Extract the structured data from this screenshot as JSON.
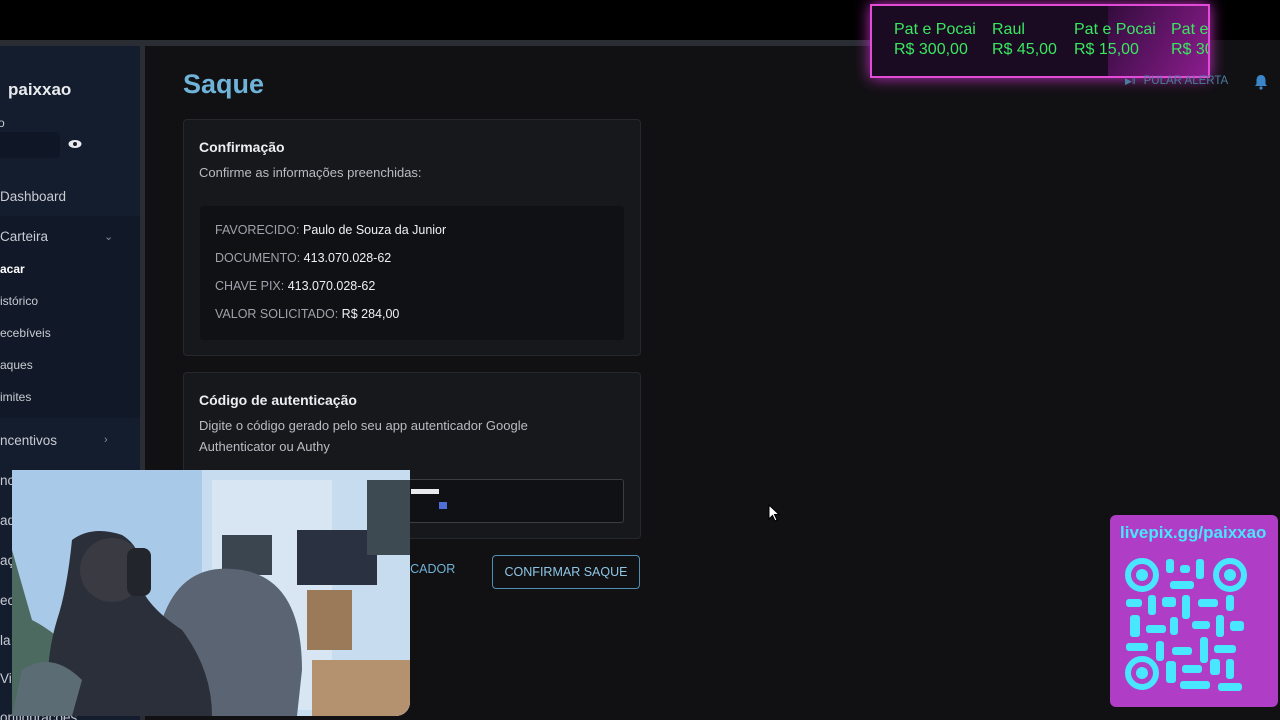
{
  "sidebar": {
    "username": "paixxao",
    "balance_label": "o",
    "items": [
      {
        "label": "Dashboard"
      },
      {
        "label": "Carteira"
      },
      {
        "label": "acar"
      },
      {
        "label": "istórico"
      },
      {
        "label": "ecebíveis"
      },
      {
        "label": "aques"
      },
      {
        "label": "imites"
      },
      {
        "label": "ncentivos"
      },
      {
        "label": "nc"
      },
      {
        "label": "ad"
      },
      {
        "label": "aç"
      },
      {
        "label": "ec"
      },
      {
        "label": "la"
      },
      {
        "label": "Vi"
      },
      {
        "label": "onfigurações"
      }
    ]
  },
  "page": {
    "title": "Saque"
  },
  "confirmation": {
    "title": "Confirmação",
    "subtitle": "Confirme as informações preenchidas:",
    "rows": [
      {
        "label": "FAVORECIDO:",
        "value": "Paulo de Souza da Junior"
      },
      {
        "label": "DOCUMENTO:",
        "value": "413.070.028-62"
      },
      {
        "label": "CHAVE PIX:",
        "value": "413.070.028-62"
      },
      {
        "label": "VALOR SOLICITADO:",
        "value": "R$ 284,00"
      }
    ]
  },
  "auth": {
    "title": "Código de autenticação",
    "line1": "Digite o código gerado pelo seu app autenticador Google",
    "line2": "Authenticator ou Authy"
  },
  "actions": {
    "authenticator_link": "NTICADOR",
    "confirm": "CONFIRMAR SAQUE"
  },
  "overlay": {
    "alerts": [
      {
        "name": "Pat e Pocai",
        "amount": "R$ 300,00"
      },
      {
        "name": "Raul",
        "amount": "R$ 45,00"
      },
      {
        "name": "Pat e Pocai",
        "amount": "R$ 15,00"
      },
      {
        "name": "Pat e",
        "amount": "R$ 30"
      }
    ],
    "skip_alert": "PULAR ALERTA",
    "livepix_url": "livepix.gg/paixxao"
  },
  "colors": {
    "accent": "#6fb3d8",
    "sidebar_bg": "#141d2e",
    "alert_green": "#39e85f",
    "overlay_pink": "#e24bd6",
    "qr_cyan": "#48e6ff"
  }
}
